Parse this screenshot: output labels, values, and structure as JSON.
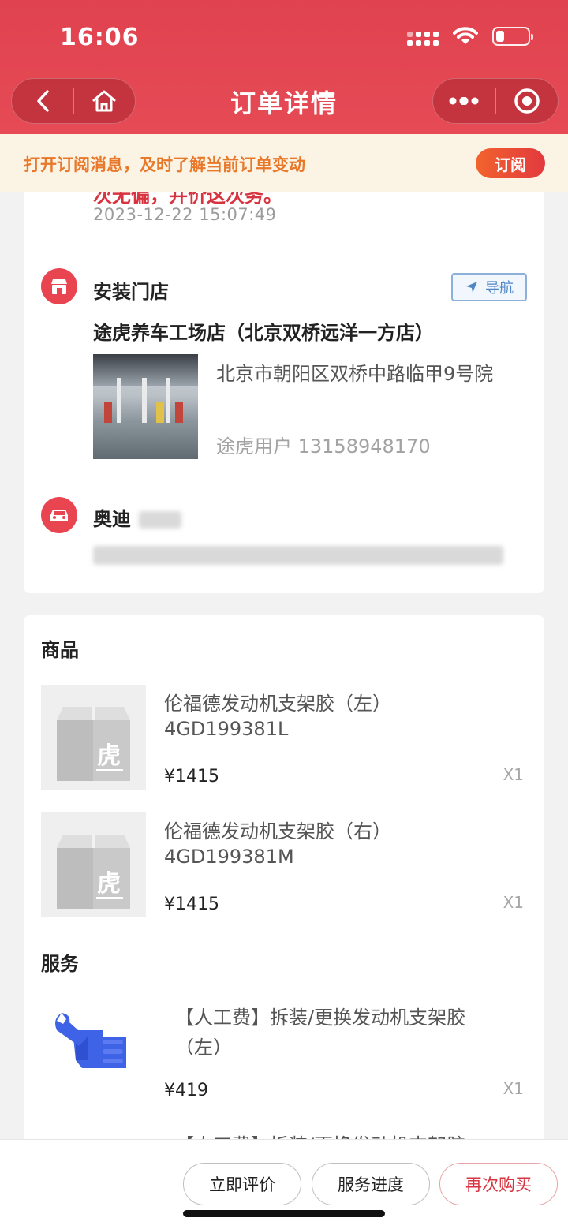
{
  "status": {
    "time": "16:06"
  },
  "nav": {
    "title": "订单详情"
  },
  "subscribe": {
    "text": "打开订阅消息，及时了解当前订单变动",
    "button": "订阅"
  },
  "timeline": {
    "truncated_text": "次无偏，并价这次务。",
    "timestamp": "2023-12-22 15:07:49"
  },
  "store": {
    "section_title": "安装门店",
    "navigate_label": "导航",
    "name": "途虎养车工场店（北京双桥远洋一方店）",
    "address": "北京市朝阳区双桥中路临甲9号院",
    "contact": "途虎用户 13158948170"
  },
  "car": {
    "brand": "奥迪"
  },
  "goods": {
    "section_title": "商品",
    "items": [
      {
        "name": "伦福德发动机支架胶（左）",
        "code": "4GD199381L",
        "price": "¥1415",
        "qty": "X1"
      },
      {
        "name": "伦福德发动机支架胶（右）",
        "code": "4GD199381M",
        "price": "¥1415",
        "qty": "X1"
      }
    ]
  },
  "services": {
    "section_title": "服务",
    "items": [
      {
        "name_line1": "【人工费】拆装/更换发动机支架胶",
        "name_line2": "（左）",
        "price": "¥419",
        "qty": "X1"
      },
      {
        "name_line1": "【人工费】拆装/更换发动机支架胶"
      }
    ]
  },
  "bottom_bar": {
    "review": "立即评价",
    "progress": "服务进度",
    "rebuy": "再次购买"
  },
  "colors": {
    "header": "#e64a55",
    "accent": "#d8343f",
    "subscribe_text": "#e8782a",
    "nav_blue": "#4f86c6"
  }
}
